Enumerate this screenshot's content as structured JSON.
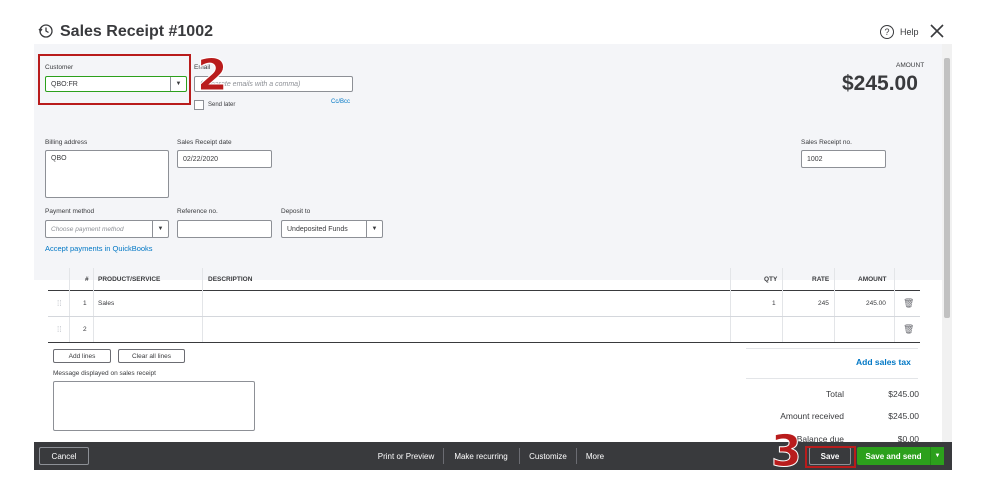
{
  "header": {
    "title": "Sales Receipt #1002",
    "help_label": "Help"
  },
  "customer": {
    "label": "Customer",
    "value": "QBO:FR"
  },
  "email": {
    "label": "Email",
    "placeholder": "(Separate emails with a comma)",
    "send_later": "Send later",
    "cc_bcc": "Cc/Bcc"
  },
  "amount": {
    "label": "AMOUNT",
    "value": "$245.00"
  },
  "billing": {
    "label": "Billing address",
    "value": "QBO"
  },
  "receipt_date": {
    "label": "Sales Receipt date",
    "value": "02/22/2020"
  },
  "receipt_no": {
    "label": "Sales Receipt no.",
    "value": "1002"
  },
  "payment": {
    "method_label": "Payment method",
    "method_placeholder": "Choose payment method",
    "ref_label": "Reference no.",
    "deposit_label": "Deposit to",
    "deposit_value": "Undeposited Funds",
    "accept_link": "Accept payments in QuickBooks"
  },
  "table": {
    "headers": {
      "num": "#",
      "product": "PRODUCT/SERVICE",
      "description": "DESCRIPTION",
      "qty": "QTY",
      "rate": "RATE",
      "amount": "AMOUNT"
    },
    "rows": [
      {
        "num": "1",
        "product": "Sales",
        "description": "",
        "qty": "1",
        "rate": "245",
        "amount": "245.00"
      },
      {
        "num": "2",
        "product": "",
        "description": "",
        "qty": "",
        "rate": "",
        "amount": ""
      }
    ]
  },
  "line_buttons": {
    "add_lines": "Add lines",
    "clear_lines": "Clear all lines"
  },
  "message": {
    "label": "Message displayed on sales receipt"
  },
  "totals": {
    "add_sales_tax": "Add sales tax",
    "total_label": "Total",
    "total_value": "$245.00",
    "received_label": "Amount received",
    "received_value": "$245.00",
    "balance_label": "Balance due",
    "balance_value": "$0.00"
  },
  "footer": {
    "cancel": "Cancel",
    "print_preview": "Print or Preview",
    "make_recurring": "Make recurring",
    "customize": "Customize",
    "more": "More",
    "save": "Save",
    "save_send": "Save and send"
  },
  "annotations": {
    "step_2": "2",
    "step_3": "3"
  },
  "colors": {
    "accent_green": "#2ca01c",
    "annotation_red": "#b91c1c",
    "link_blue": "#0077c5",
    "footer_bg": "#393a3d"
  }
}
